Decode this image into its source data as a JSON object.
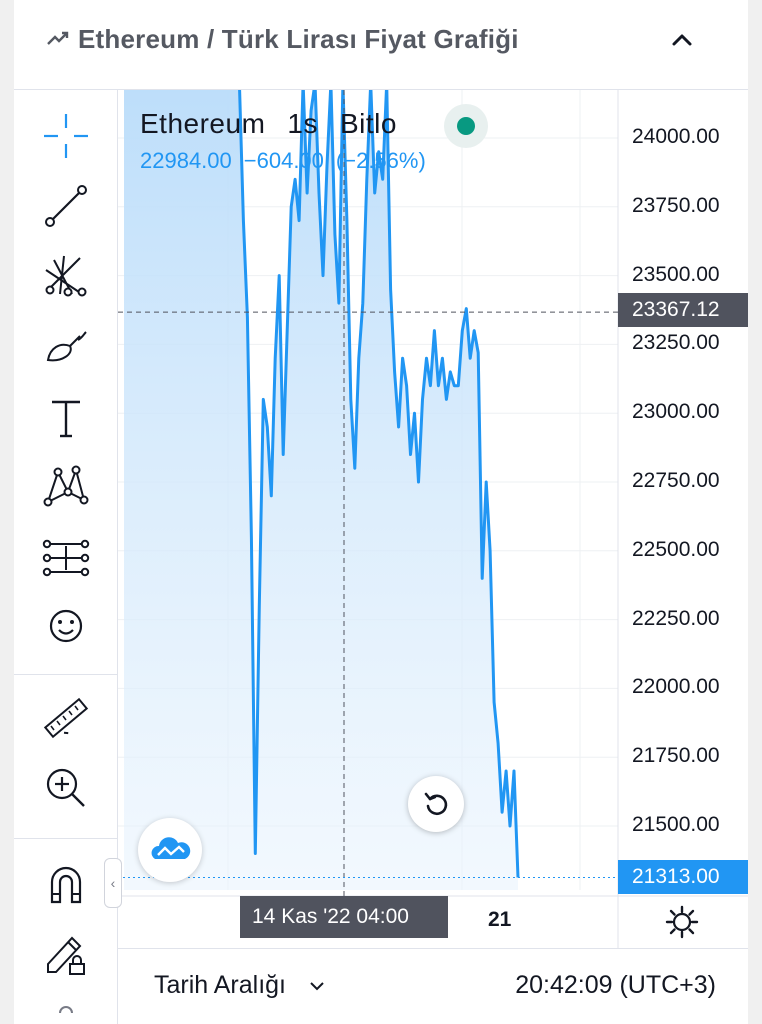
{
  "header": {
    "title": "Ethereum / Türk Lirası Fiyat Grafiği",
    "icon": "trend-up-icon",
    "collapse_icon": "chevron-up-icon"
  },
  "toolbar": {
    "tools": [
      "crosshair-icon",
      "trend-line-icon",
      "pitchfork-icon",
      "brush-icon",
      "text-icon",
      "pattern-icon",
      "measure-levels-icon",
      "emoji-icon",
      "ruler-icon",
      "zoom-in-icon",
      "magnet-icon",
      "lock-drawing-icon"
    ]
  },
  "legend": {
    "symbol": "Ethereum",
    "interval": "1s",
    "exchange": "Bitlo",
    "last": "22984.00",
    "change": "−604.00",
    "change_pct": "(−2.56%)",
    "status_color": "#089981"
  },
  "price_axis": {
    "ticks": [
      "24000.00",
      "23750.00",
      "23500.00",
      "23250.00",
      "23000.00",
      "22750.00",
      "22500.00",
      "22250.00",
      "22000.00",
      "21750.00",
      "21500.00"
    ],
    "crosshair_price": "23367.12",
    "last_price": "21313.00"
  },
  "time_axis": {
    "crosshair_time": "14 Kas '22   04:00",
    "tick": "21"
  },
  "footer": {
    "range_label": "Tarih Aralığı",
    "clock": "20:42:09 (UTC+3)"
  },
  "chart_data": {
    "type": "area",
    "title": "",
    "xlabel": "",
    "ylabel": "",
    "ylim": [
      21300,
      24160
    ],
    "line_color": "#2196f3",
    "fill_color": "#cfe6fb",
    "points": [
      [
        0,
        24200
      ],
      [
        1,
        24200
      ],
      [
        2,
        24200
      ],
      [
        3,
        24200
      ],
      [
        4,
        24200
      ],
      [
        5,
        24200
      ],
      [
        6,
        24200
      ],
      [
        7,
        24200
      ],
      [
        8,
        24200
      ],
      [
        9,
        24200
      ],
      [
        10,
        24200
      ],
      [
        11,
        24200
      ],
      [
        12,
        24200
      ],
      [
        13,
        24200
      ],
      [
        14,
        24200
      ],
      [
        15,
        24200
      ],
      [
        16,
        24200
      ],
      [
        17,
        24200
      ],
      [
        18,
        24200
      ],
      [
        19,
        24200
      ],
      [
        20,
        24200
      ],
      [
        21,
        24200
      ],
      [
        22,
        24200
      ],
      [
        23,
        24200
      ],
      [
        24,
        24200
      ],
      [
        25,
        24200
      ],
      [
        26,
        24200
      ],
      [
        27,
        24200
      ],
      [
        28,
        24200
      ],
      [
        29,
        24200
      ],
      [
        30,
        23700
      ],
      [
        31,
        23350
      ],
      [
        32,
        22550
      ],
      [
        33,
        21400
      ],
      [
        34,
        22300
      ],
      [
        35,
        23050
      ],
      [
        36,
        22950
      ],
      [
        37,
        22700
      ],
      [
        38,
        23200
      ],
      [
        39,
        23500
      ],
      [
        40,
        22850
      ],
      [
        41,
        23300
      ],
      [
        42,
        23750
      ],
      [
        43,
        23850
      ],
      [
        44,
        23700
      ],
      [
        45,
        24200
      ],
      [
        46,
        23800
      ],
      [
        47,
        24100
      ],
      [
        48,
        24200
      ],
      [
        49,
        23800
      ],
      [
        50,
        23500
      ],
      [
        51,
        23900
      ],
      [
        52,
        24200
      ],
      [
        53,
        23650
      ],
      [
        54,
        23400
      ],
      [
        55,
        24200
      ],
      [
        56,
        23700
      ],
      [
        57,
        23050
      ],
      [
        58,
        22800
      ],
      [
        59,
        23200
      ],
      [
        60,
        23400
      ],
      [
        61,
        23850
      ],
      [
        62,
        24200
      ],
      [
        63,
        23800
      ],
      [
        64,
        23950
      ],
      [
        65,
        23850
      ],
      [
        66,
        24200
      ],
      [
        67,
        23450
      ],
      [
        68,
        23150
      ],
      [
        69,
        22950
      ],
      [
        70,
        23200
      ],
      [
        71,
        23100
      ],
      [
        72,
        22850
      ],
      [
        73,
        23000
      ],
      [
        74,
        22750
      ],
      [
        75,
        23050
      ],
      [
        76,
        23200
      ],
      [
        77,
        23100
      ],
      [
        78,
        23300
      ],
      [
        79,
        23100
      ],
      [
        80,
        23200
      ],
      [
        81,
        23050
      ],
      [
        82,
        23150
      ],
      [
        83,
        23100
      ],
      [
        84,
        23100
      ],
      [
        85,
        23300
      ],
      [
        86,
        23380
      ],
      [
        87,
        23200
      ],
      [
        88,
        23300
      ],
      [
        89,
        23220
      ],
      [
        90,
        22400
      ],
      [
        91,
        22750
      ],
      [
        92,
        22500
      ],
      [
        93,
        21950
      ],
      [
        94,
        21800
      ],
      [
        95,
        21550
      ],
      [
        96,
        21700
      ],
      [
        97,
        21500
      ],
      [
        98,
        21700
      ],
      [
        99,
        21313
      ]
    ]
  }
}
